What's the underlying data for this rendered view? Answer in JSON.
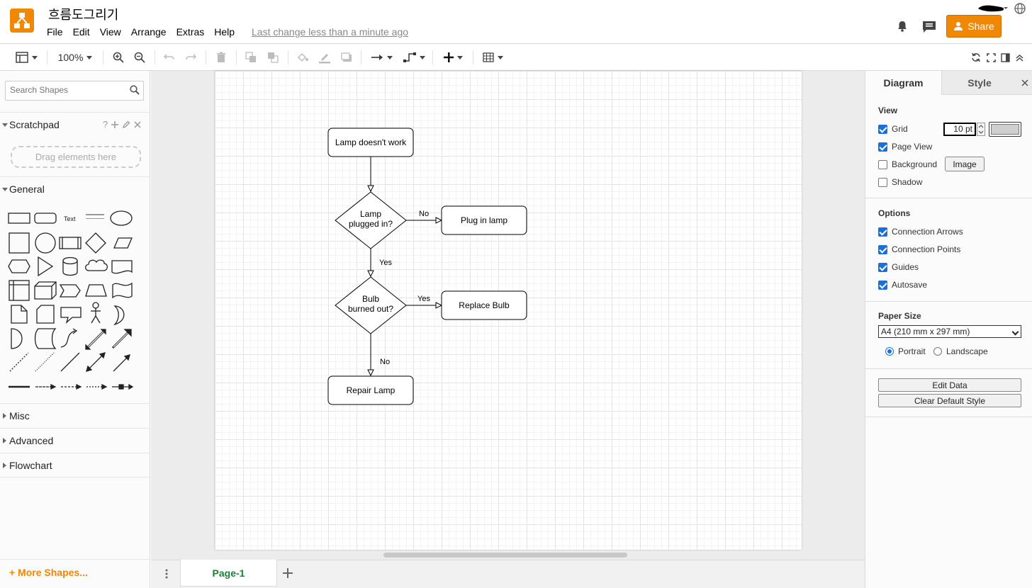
{
  "header": {
    "title": "흐름도그리기",
    "menu": [
      "File",
      "Edit",
      "View",
      "Arrange",
      "Extras",
      "Help"
    ],
    "last_change": "Last change less than a minute ago",
    "share_label": "Share",
    "brand_color": "#f08705"
  },
  "toolbar": {
    "zoom": "100%"
  },
  "sidebar": {
    "search_placeholder": "Search Shapes",
    "scratchpad_label": "Scratchpad",
    "scratchpad_help": "?",
    "drop_hint": "Drag elements here",
    "general_label": "General",
    "text_shape_label": "Text",
    "sections": [
      "Misc",
      "Advanced",
      "Flowchart"
    ],
    "more_shapes": "More Shapes..."
  },
  "diagram": {
    "nodes": {
      "start": "Lamp doesn't work",
      "plugged_line1": "Lamp",
      "plugged_line2": "plugged in?",
      "plug_in": "Plug in lamp",
      "bulb_line1": "Bulb",
      "bulb_line2": "burned out?",
      "replace": "Replace Bulb",
      "repair": "Repair Lamp"
    },
    "edges": {
      "plugged_no": "No",
      "plugged_yes": "Yes",
      "bulb_yes": "Yes",
      "bulb_no": "No"
    }
  },
  "pages": {
    "active_tab": "Page-1"
  },
  "panel": {
    "tabs": [
      "Diagram",
      "Style"
    ],
    "view_heading": "View",
    "view_options": [
      {
        "label": "Grid",
        "checked": true
      },
      {
        "label": "Page View",
        "checked": true
      },
      {
        "label": "Background",
        "checked": false
      },
      {
        "label": "Shadow",
        "checked": false
      }
    ],
    "grid_size": "10 pt",
    "grid_color": "#cfcfcf",
    "image_button": "Image",
    "options_heading": "Options",
    "options": [
      {
        "label": "Connection Arrows",
        "checked": true
      },
      {
        "label": "Connection Points",
        "checked": true
      },
      {
        "label": "Guides",
        "checked": true
      },
      {
        "label": "Autosave",
        "checked": true
      }
    ],
    "paper_heading": "Paper Size",
    "paper_size": "A4 (210 mm x 297 mm)",
    "orientation": [
      {
        "label": "Portrait",
        "selected": true
      },
      {
        "label": "Landscape",
        "selected": false
      }
    ],
    "edit_data": "Edit Data",
    "clear_style": "Clear Default Style"
  }
}
